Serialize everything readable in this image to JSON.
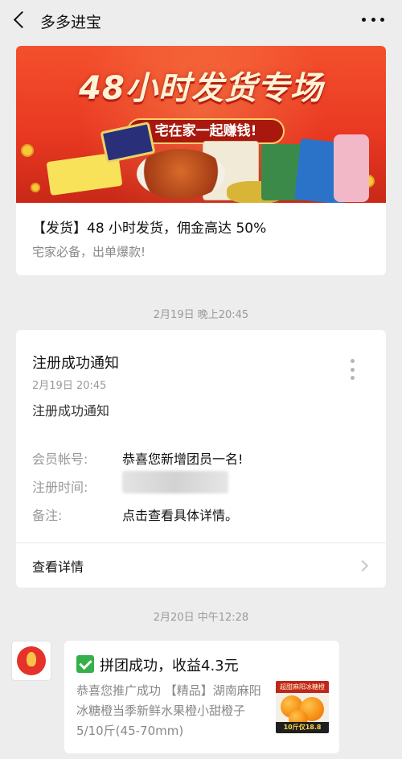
{
  "header": {
    "title": "多多进宝",
    "back_icon": "chevron-left-icon",
    "more_icon": "more-dots-icon"
  },
  "banner_message": {
    "image_headline": "48小时发货专场",
    "image_pill": "宅在家一起赚钱!",
    "line1": "【发货】48 小时发货，佣金高达 50%",
    "line2": "宅家必备，出单爆款!"
  },
  "timestamps": {
    "first": "2月19日 晚上20:45",
    "second": "2月20日 中午12:28"
  },
  "notification": {
    "title": "注册成功通知",
    "date": "2月19日  20:45",
    "subtitle": "注册成功通知",
    "rows": [
      {
        "label": "会员帐号:",
        "value": "恭喜您新增团员一名!"
      },
      {
        "label": "注册时间:",
        "value": ""
      },
      {
        "label": "备注:",
        "value": "点击查看具体详情。"
      }
    ],
    "detail_link": "查看详情"
  },
  "chat": {
    "title": "拼团成功，收益4.3元",
    "description": "恭喜您推广成功 【精品】湖南麻阳冰糖橙当季新鲜水果橙小甜橙子5/10斤(45-70mm)",
    "thumb_top": "超甜麻阳冰糖橙",
    "thumb_price": "10斤仅18.8"
  },
  "colors": {
    "banner_red": "#e93922",
    "check_green": "#35b04a",
    "background": "#ededed"
  }
}
